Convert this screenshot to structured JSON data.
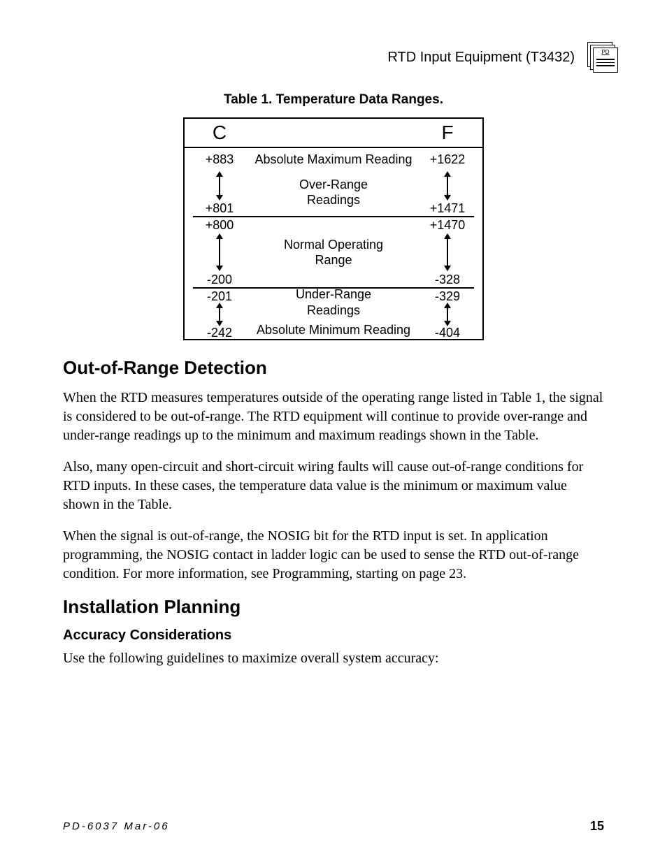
{
  "header": {
    "title": "RTD  Input  Equipment (T3432)",
    "icon_label": "PD"
  },
  "table": {
    "caption": "Table 1.  Temperature Data Ranges.",
    "head": {
      "c": "C",
      "f": "F"
    },
    "abs_max": {
      "c": "+883",
      "label": "Absolute Maximum Reading",
      "f": "+1622"
    },
    "over": {
      "c_top": "",
      "c_bot": "+801",
      "label": "Over-Range\nReadings",
      "f_top": "",
      "f_bot": "+1471"
    },
    "normal": {
      "c_top": "+800",
      "c_bot": "-200",
      "label": "Normal Operating\nRange",
      "f_top": "+1470",
      "f_bot": "-328"
    },
    "under": {
      "c_top": "-201",
      "c_bot": "-242",
      "label": "Under-Range\nReadings",
      "f_top": "-329",
      "f_bot": "-404"
    },
    "abs_min_label": "Absolute Minimum Reading"
  },
  "sections": {
    "oor_heading": "Out-of-Range Detection",
    "oor_p1": "When the RTD measures temperatures outside of the operating range listed in Table 1, the signal is considered to be out-of-range.  The RTD equipment will continue to provide over-range and under-range readings up to the minimum and maximum readings shown in the Table.",
    "oor_p2": "Also, many open-circuit and short-circuit wiring faults will cause out-of-range conditions for RTD inputs.  In these cases, the temperature data value is the minimum or maximum value shown in the Table.",
    "oor_p3": "When the signal is out-of-range, the NOSIG bit for the RTD input is set.  In application programming, the NOSIG contact in ladder logic can be used to sense the RTD out-of-range condition.  For more information, see Programming, starting on page 23.",
    "install_heading": "Installation Planning",
    "accuracy_sub": "Accuracy Considerations",
    "accuracy_p": "Use the following guidelines to maximize overall system accuracy:"
  },
  "footer": {
    "left": "PD-6037  Mar-06",
    "right": "15"
  },
  "chart_data": {
    "type": "table",
    "title": "Table 1. Temperature Data Ranges.",
    "columns": [
      "Label",
      "Celsius",
      "Fahrenheit"
    ],
    "rows": [
      [
        "Absolute Maximum Reading",
        883,
        1622
      ],
      [
        "Over-Range Readings (upper bound)",
        883,
        1622
      ],
      [
        "Over-Range Readings (lower bound)",
        801,
        1471
      ],
      [
        "Normal Operating Range (upper bound)",
        800,
        1470
      ],
      [
        "Normal Operating Range (lower bound)",
        -200,
        -328
      ],
      [
        "Under-Range Readings (upper bound)",
        -201,
        -329
      ],
      [
        "Under-Range Readings (lower bound)",
        -242,
        -404
      ],
      [
        "Absolute Minimum Reading",
        -242,
        -404
      ]
    ]
  }
}
